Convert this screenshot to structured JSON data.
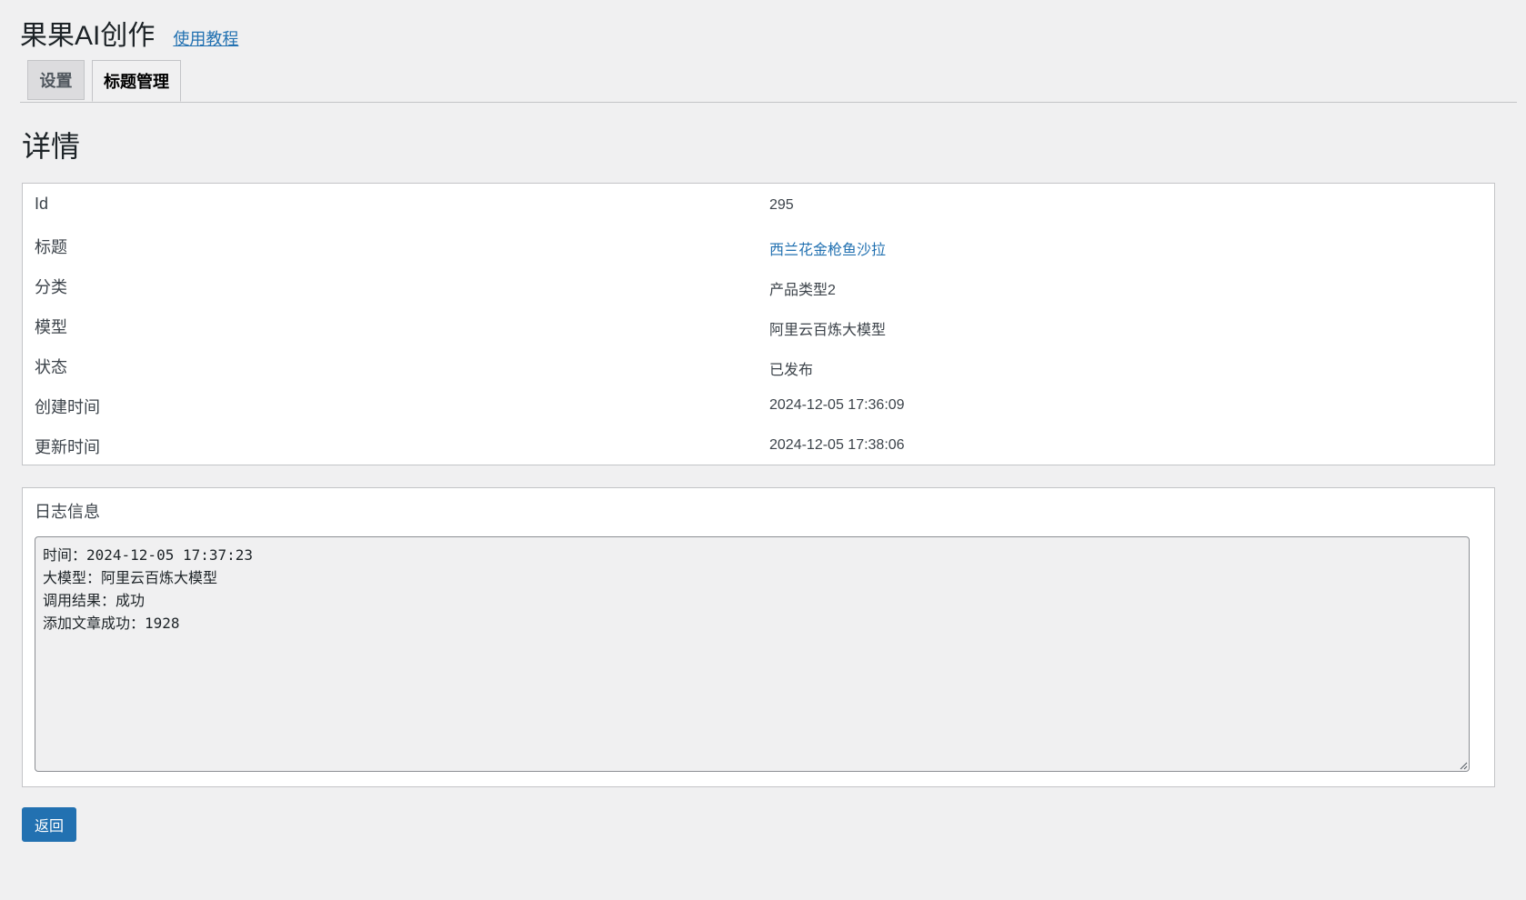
{
  "header": {
    "title": "果果AI创作",
    "tutorial_link": "使用教程"
  },
  "tabs": [
    {
      "label": "设置",
      "active": false
    },
    {
      "label": "标题管理",
      "active": true
    }
  ],
  "section_title": "详情",
  "details": [
    {
      "label": "Id",
      "value": "295"
    },
    {
      "label": "标题",
      "value": "西兰花金枪鱼沙拉"
    },
    {
      "label": "分类",
      "value": "产品类型2"
    },
    {
      "label": "模型",
      "value": "阿里云百炼大模型"
    },
    {
      "label": "状态",
      "value": "已发布"
    },
    {
      "label": "创建时间",
      "value": "2024-12-05 17:36:09"
    },
    {
      "label": "更新时间",
      "value": "2024-12-05 17:38:06"
    }
  ],
  "log": {
    "title": "日志信息",
    "content": "时间：2024-12-05 17:37:23\n大模型：阿里云百炼大模型\n调用结果：成功\n添加文章成功：1928"
  },
  "back_button_label": "返回",
  "colors": {
    "accent": "#2271b1",
    "background": "#f0f0f1",
    "border": "#c3c4c7"
  }
}
